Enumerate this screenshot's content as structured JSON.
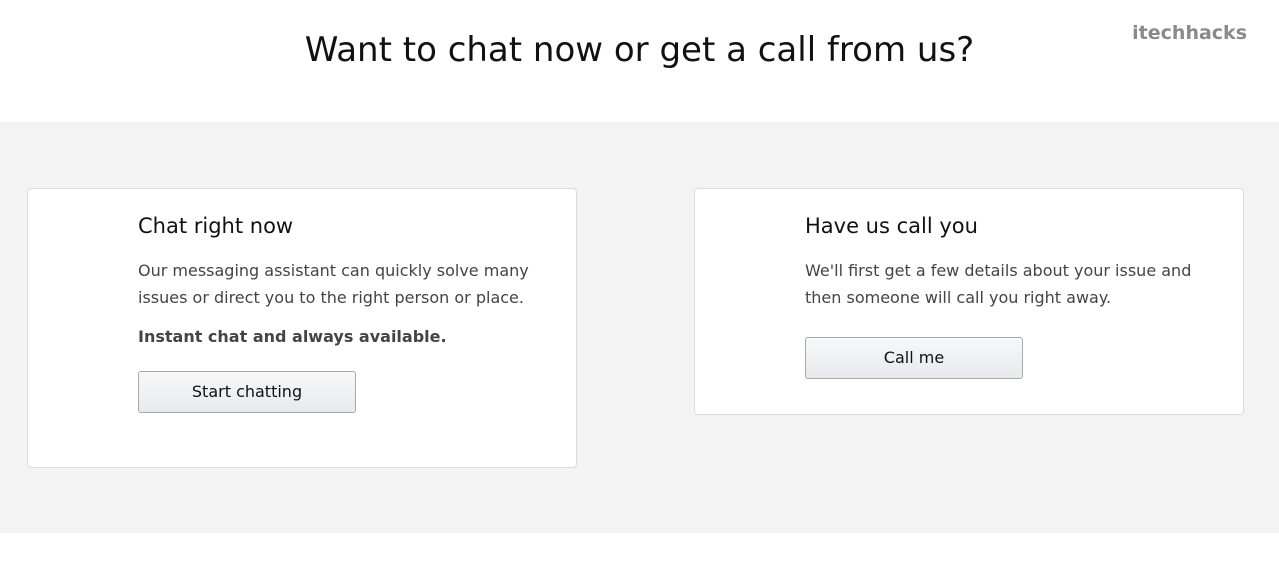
{
  "page": {
    "title": "Want to chat now or get a call from us?",
    "watermark": "itechhacks"
  },
  "chat_card": {
    "title": "Chat right now",
    "description": "Our messaging assistant can quickly solve many issues or direct you to the right person or place.",
    "emphasis": "Instant chat and always available.",
    "button_label": "Start chatting"
  },
  "call_card": {
    "title": "Have us call you",
    "description": "We'll first get a few details about your issue and then someone will call you right away.",
    "button_label": "Call me"
  },
  "colors": {
    "background": "#ffffff",
    "band": "#f3f3f3",
    "card_border": "#dcdcdc",
    "text_primary": "#111111",
    "text_secondary": "#444444",
    "watermark": "#8a8a8a"
  }
}
